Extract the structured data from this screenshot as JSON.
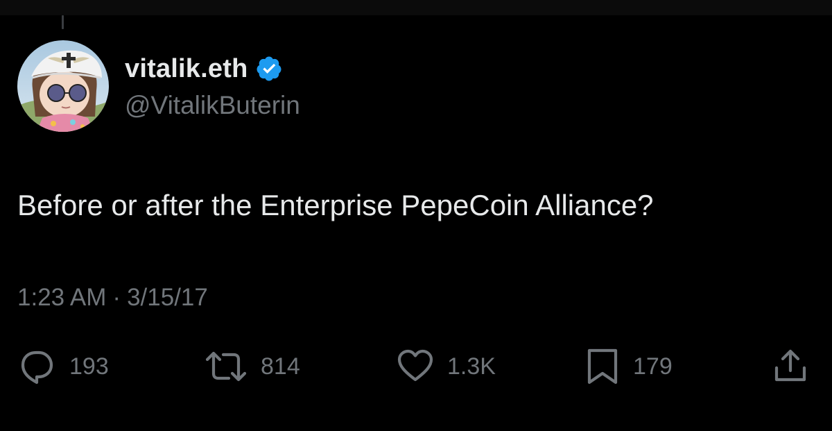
{
  "colors": {
    "background": "#000000",
    "primary_text": "#e7e9ea",
    "secondary_text": "#71767b",
    "verified_badge": "#1d9bf0"
  },
  "tweet": {
    "author": {
      "display_name": "vitalik.eth",
      "handle": "@VitalikButerin",
      "verified": true,
      "avatar_icon": "avatar-image"
    },
    "text": "Before or after the Enterprise PepeCoin Alliance?",
    "time": "1:23 AM",
    "separator": "·",
    "date": "3/15/17",
    "actions": {
      "replies": {
        "icon": "reply-icon",
        "count": "193"
      },
      "retweets": {
        "icon": "retweet-icon",
        "count": "814"
      },
      "likes": {
        "icon": "heart-icon",
        "count": "1.3K"
      },
      "bookmarks": {
        "icon": "bookmark-icon",
        "count": "179"
      },
      "share": {
        "icon": "share-icon"
      }
    }
  }
}
